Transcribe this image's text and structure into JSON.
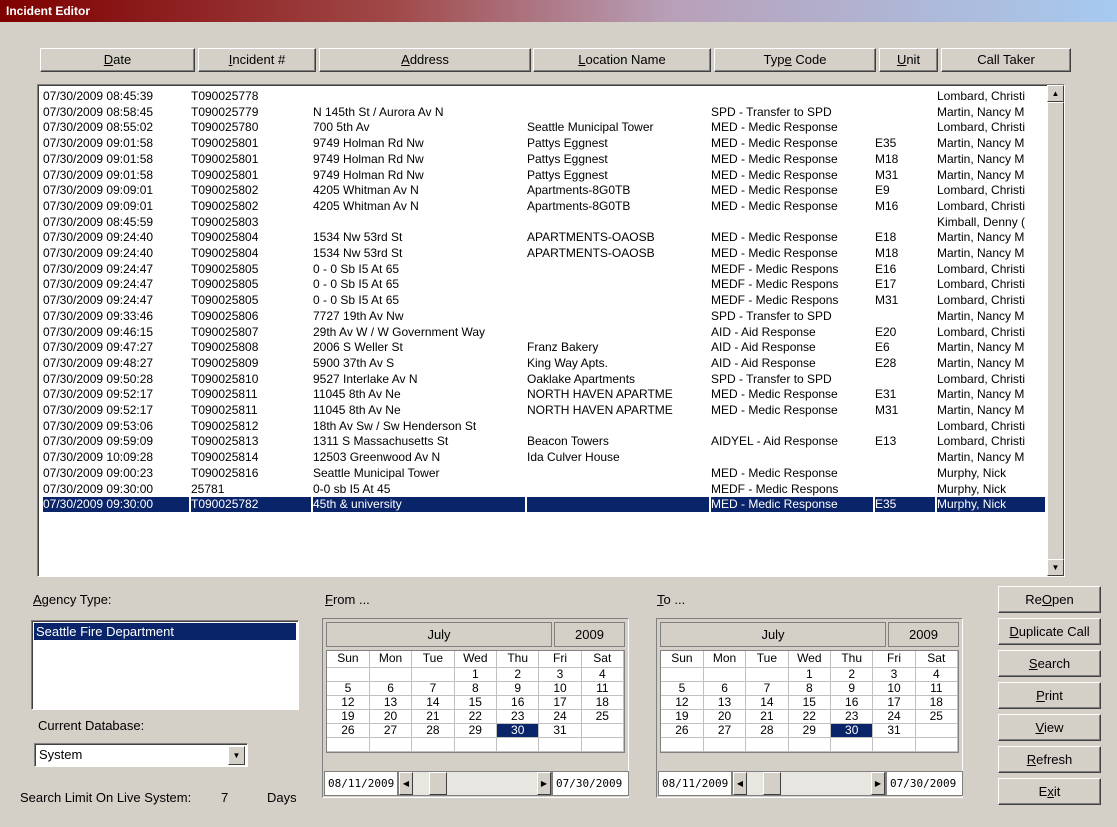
{
  "window": {
    "title": "Incident Editor"
  },
  "columns": [
    {
      "pre": "",
      "key": "D",
      "post": "ate"
    },
    {
      "pre": "",
      "key": "I",
      "post": "ncident #"
    },
    {
      "pre": "",
      "key": "A",
      "post": "ddress"
    },
    {
      "pre": "",
      "key": "L",
      "post": "ocation Name"
    },
    {
      "pre": "Typ",
      "key": "e",
      "post": " Code"
    },
    {
      "pre": "",
      "key": "U",
      "post": "nit"
    },
    {
      "pre": "Call Taker",
      "key": "",
      "post": ""
    }
  ],
  "rows": [
    {
      "date": "07/30/2009 08:45:39",
      "inc": "T090025778",
      "addr": "",
      "loc": "",
      "type": "",
      "unit": "",
      "taker": "Lombard, Christi"
    },
    {
      "date": "07/30/2009 08:58:45",
      "inc": "T090025779",
      "addr": "N 145th St / Aurora Av N",
      "loc": "",
      "type": "SPD - Transfer to SPD",
      "unit": "",
      "taker": "Martin, Nancy M"
    },
    {
      "date": "07/30/2009 08:55:02",
      "inc": "T090025780",
      "addr": "700 5th Av",
      "loc": "Seattle Municipal Tower",
      "type": "MED - Medic Response",
      "unit": "",
      "taker": "Lombard, Christi"
    },
    {
      "date": "07/30/2009 09:01:58",
      "inc": "T090025801",
      "addr": "9749 Holman Rd Nw",
      "loc": "Pattys Eggnest",
      "type": "MED - Medic Response",
      "unit": "E35",
      "taker": "Martin, Nancy M"
    },
    {
      "date": "07/30/2009 09:01:58",
      "inc": "T090025801",
      "addr": "9749 Holman Rd Nw",
      "loc": "Pattys Eggnest",
      "type": "MED - Medic Response",
      "unit": "M18",
      "taker": "Martin, Nancy M"
    },
    {
      "date": "07/30/2009 09:01:58",
      "inc": "T090025801",
      "addr": "9749 Holman Rd Nw",
      "loc": "Pattys Eggnest",
      "type": "MED - Medic Response",
      "unit": "M31",
      "taker": "Martin, Nancy M"
    },
    {
      "date": "07/30/2009 09:09:01",
      "inc": "T090025802",
      "addr": "4205 Whitman Av N",
      "loc": "Apartments-8G0TB",
      "type": "MED - Medic Response",
      "unit": "E9",
      "taker": "Lombard, Christi"
    },
    {
      "date": "07/30/2009 09:09:01",
      "inc": "T090025802",
      "addr": "4205 Whitman Av N",
      "loc": "Apartments-8G0TB",
      "type": "MED - Medic Response",
      "unit": "M16",
      "taker": "Lombard, Christi"
    },
    {
      "date": "07/30/2009 08:45:59",
      "inc": "T090025803",
      "addr": "",
      "loc": "",
      "type": "",
      "unit": "",
      "taker": "Kimball, Denny ("
    },
    {
      "date": "07/30/2009 09:24:40",
      "inc": "T090025804",
      "addr": "1534 Nw 53rd St",
      "loc": "APARTMENTS-OAOSB",
      "type": "MED - Medic Response",
      "unit": "E18",
      "taker": "Martin, Nancy M"
    },
    {
      "date": "07/30/2009 09:24:40",
      "inc": "T090025804",
      "addr": "1534 Nw 53rd St",
      "loc": "APARTMENTS-OAOSB",
      "type": "MED - Medic Response",
      "unit": "M18",
      "taker": "Martin, Nancy M"
    },
    {
      "date": "07/30/2009 09:24:47",
      "inc": "T090025805",
      "addr": "0 - 0 Sb I5 At 65",
      "loc": "",
      "type": "MEDF - Medic Respons",
      "unit": "E16",
      "taker": "Lombard, Christi"
    },
    {
      "date": "07/30/2009 09:24:47",
      "inc": "T090025805",
      "addr": "0 - 0 Sb I5 At 65",
      "loc": "",
      "type": "MEDF - Medic Respons",
      "unit": "E17",
      "taker": "Lombard, Christi"
    },
    {
      "date": "07/30/2009 09:24:47",
      "inc": "T090025805",
      "addr": "0 - 0 Sb I5 At 65",
      "loc": "",
      "type": "MEDF - Medic Respons",
      "unit": "M31",
      "taker": "Lombard, Christi"
    },
    {
      "date": "07/30/2009 09:33:46",
      "inc": "T090025806",
      "addr": "7727 19th Av Nw",
      "loc": "",
      "type": "SPD - Transfer to SPD",
      "unit": "",
      "taker": "Martin, Nancy M"
    },
    {
      "date": "07/30/2009 09:46:15",
      "inc": "T090025807",
      "addr": "29th Av W / W Government Way",
      "loc": "",
      "type": "AID - Aid Response",
      "unit": "E20",
      "taker": "Lombard, Christi"
    },
    {
      "date": "07/30/2009 09:47:27",
      "inc": "T090025808",
      "addr": "2006 S Weller St",
      "loc": "Franz Bakery",
      "type": "AID - Aid Response",
      "unit": "E6",
      "taker": "Martin, Nancy M"
    },
    {
      "date": "07/30/2009 09:48:27",
      "inc": "T090025809",
      "addr": "5900 37th Av S",
      "loc": "King Way Apts.",
      "type": "AID - Aid Response",
      "unit": "E28",
      "taker": "Martin, Nancy M"
    },
    {
      "date": "07/30/2009 09:50:28",
      "inc": "T090025810",
      "addr": "9527 Interlake Av N",
      "loc": "Oaklake Apartments",
      "type": "SPD - Transfer to SPD",
      "unit": "",
      "taker": "Lombard, Christi"
    },
    {
      "date": "07/30/2009 09:52:17",
      "inc": "T090025811",
      "addr": "11045 8th Av Ne",
      "loc": "NORTH HAVEN APARTME",
      "type": "MED - Medic Response",
      "unit": "E31",
      "taker": "Martin, Nancy M"
    },
    {
      "date": "07/30/2009 09:52:17",
      "inc": "T090025811",
      "addr": "11045 8th Av Ne",
      "loc": "NORTH HAVEN APARTME",
      "type": "MED - Medic Response",
      "unit": "M31",
      "taker": "Martin, Nancy M"
    },
    {
      "date": "07/30/2009 09:53:06",
      "inc": "T090025812",
      "addr": "18th Av Sw / Sw Henderson St",
      "loc": "",
      "type": "",
      "unit": "",
      "taker": "Lombard, Christi"
    },
    {
      "date": "07/30/2009 09:59:09",
      "inc": "T090025813",
      "addr": "1311 S Massachusetts St",
      "loc": "Beacon Towers",
      "type": "AIDYEL - Aid Response",
      "unit": "E13",
      "taker": "Lombard, Christi"
    },
    {
      "date": "07/30/2009 10:09:28",
      "inc": "T090025814",
      "addr": "12503 Greenwood Av N",
      "loc": "Ida Culver House",
      "type": "",
      "unit": "",
      "taker": "Martin, Nancy M"
    },
    {
      "date": "07/30/2009 09:00:23",
      "inc": "T090025816",
      "addr": "Seattle Municipal Tower",
      "loc": "",
      "type": "MED - Medic Response",
      "unit": "",
      "taker": "Murphy, Nick"
    },
    {
      "date": "07/30/2009 09:30:00",
      "inc": "25781",
      "addr": "0-0 sb I5 At 45",
      "loc": "",
      "type": "MEDF - Medic Respons",
      "unit": "",
      "taker": "Murphy, Nick"
    },
    {
      "date": "07/30/2009 09:30:00",
      "inc": "T090025782",
      "addr": "45th & university",
      "loc": "",
      "type": "MED - Medic Response",
      "unit": "E35",
      "taker": "Murphy, Nick",
      "selected": true
    }
  ],
  "agency": {
    "label_key": "A",
    "label_rest": "gency Type:",
    "items": [
      "Seattle Fire Department"
    ]
  },
  "database": {
    "label": "Current Database:",
    "value": "System"
  },
  "search_limit": {
    "label": "Search Limit On Live System:",
    "value": "7",
    "unit": "Days"
  },
  "from": {
    "label_key": "F",
    "label_rest": "rom ...",
    "month": "July",
    "year": "2009",
    "start_date": "08/11/2009",
    "end_date": "07/30/2009"
  },
  "to": {
    "label_key": "T",
    "label_rest": "o ...",
    "month": "July",
    "year": "2009",
    "start_date": "08/11/2009",
    "end_date": "07/30/2009"
  },
  "calendar": {
    "dow": [
      "Sun",
      "Mon",
      "Tue",
      "Wed",
      "Thu",
      "Fri",
      "Sat"
    ],
    "weeks": [
      [
        "",
        "",
        "",
        "1",
        "2",
        "3",
        "4"
      ],
      [
        "5",
        "6",
        "7",
        "8",
        "9",
        "10",
        "11"
      ],
      [
        "12",
        "13",
        "14",
        "15",
        "16",
        "17",
        "18"
      ],
      [
        "19",
        "20",
        "21",
        "22",
        "23",
        "24",
        "25"
      ],
      [
        "26",
        "27",
        "28",
        "29",
        "30",
        "31",
        ""
      ],
      [
        "",
        "",
        "",
        "",
        "",
        "",
        ""
      ]
    ],
    "selected_day": "30"
  },
  "buttons": [
    {
      "pre": "Re",
      "key": "O",
      "post": "pen"
    },
    {
      "pre": "",
      "key": "D",
      "post": "uplicate Call"
    },
    {
      "pre": "",
      "key": "S",
      "post": "earch"
    },
    {
      "pre": "",
      "key": "P",
      "post": "rint"
    },
    {
      "pre": "",
      "key": "V",
      "post": "iew"
    },
    {
      "pre": "",
      "key": "R",
      "post": "efresh"
    },
    {
      "pre": "E",
      "key": "x",
      "post": "it"
    }
  ],
  "icons": {
    "scroll_up": "scroll-up-arrow-icon",
    "scroll_down": "scroll-down-arrow-icon",
    "dropdown": "dropdown-arrow-icon"
  },
  "colors": {
    "selection": "#0a246a",
    "title_start": "#7f0000",
    "title_end": "#a6caf0",
    "face": "#d4d0c8"
  }
}
